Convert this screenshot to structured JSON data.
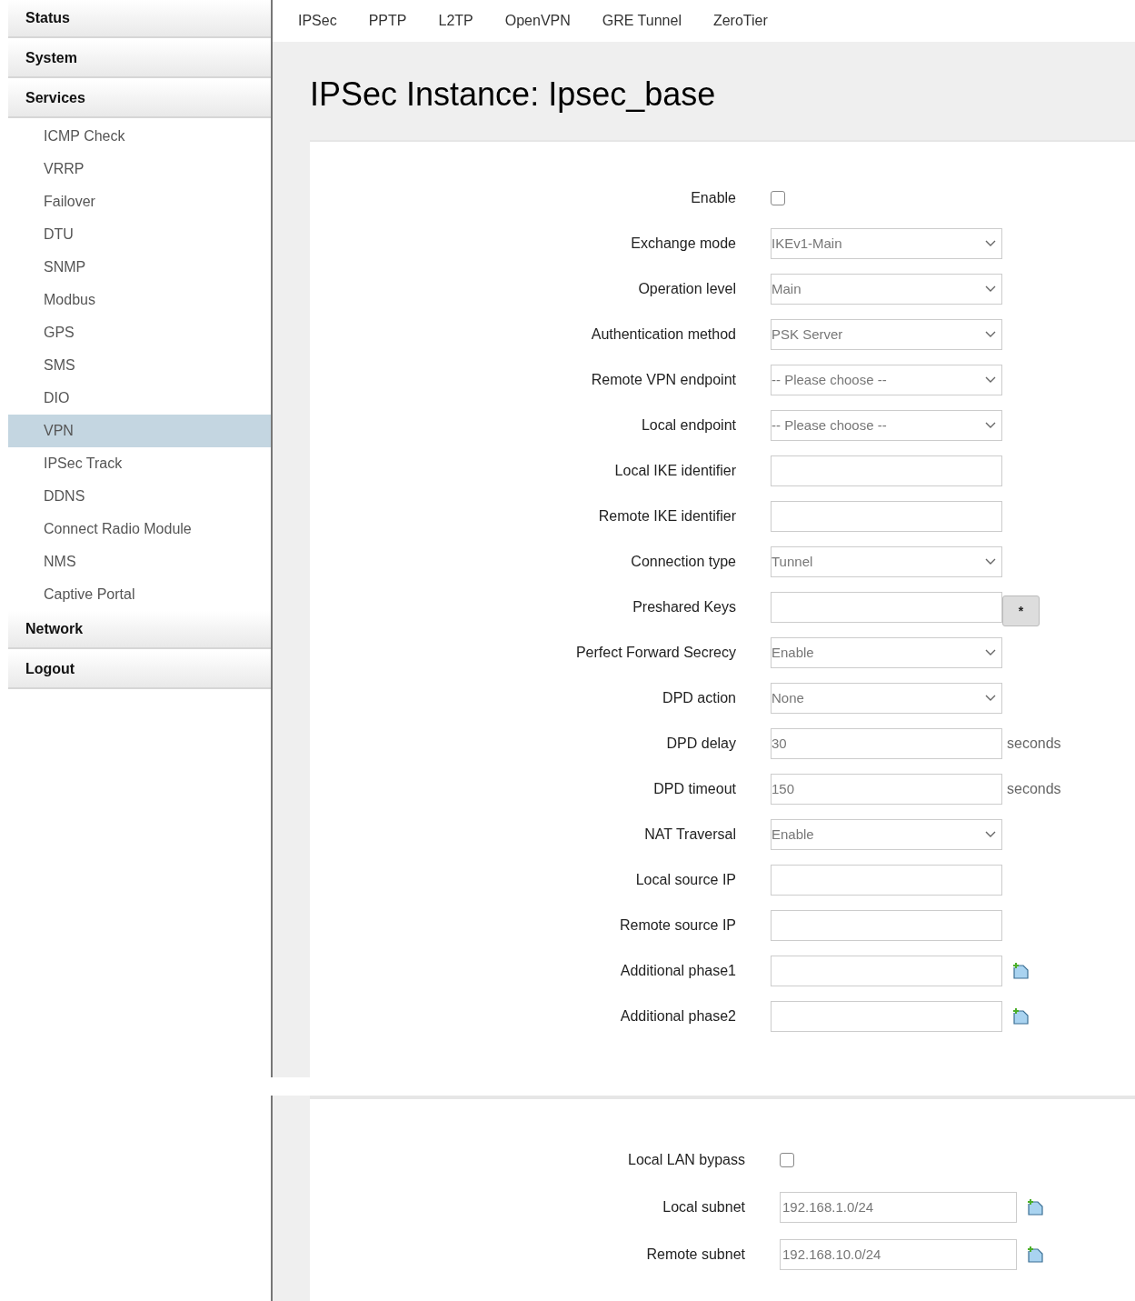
{
  "sidebar": {
    "items": [
      {
        "label": "Status",
        "kind": "header",
        "selected": false
      },
      {
        "label": "System",
        "kind": "header",
        "selected": false
      },
      {
        "label": "Services",
        "kind": "header",
        "selected": false
      },
      {
        "label": "ICMP Check",
        "kind": "sub",
        "selected": false
      },
      {
        "label": "VRRP",
        "kind": "sub",
        "selected": false
      },
      {
        "label": "Failover",
        "kind": "sub",
        "selected": false
      },
      {
        "label": "DTU",
        "kind": "sub",
        "selected": false
      },
      {
        "label": "SNMP",
        "kind": "sub",
        "selected": false
      },
      {
        "label": "Modbus",
        "kind": "sub",
        "selected": false
      },
      {
        "label": "GPS",
        "kind": "sub",
        "selected": false
      },
      {
        "label": "SMS",
        "kind": "sub",
        "selected": false
      },
      {
        "label": "DIO",
        "kind": "sub",
        "selected": false
      },
      {
        "label": "VPN",
        "kind": "sub",
        "selected": true
      },
      {
        "label": "IPSec Track",
        "kind": "sub",
        "selected": false
      },
      {
        "label": "DDNS",
        "kind": "sub",
        "selected": false
      },
      {
        "label": "Connect Radio Module",
        "kind": "sub",
        "selected": false
      },
      {
        "label": "NMS",
        "kind": "sub",
        "selected": false
      },
      {
        "label": "Captive Portal",
        "kind": "sub",
        "selected": false
      },
      {
        "label": "Network",
        "kind": "header",
        "selected": false
      },
      {
        "label": "Logout",
        "kind": "header",
        "selected": false
      }
    ]
  },
  "tabs": [
    {
      "label": "IPSec"
    },
    {
      "label": "PPTP"
    },
    {
      "label": "L2TP"
    },
    {
      "label": "OpenVPN"
    },
    {
      "label": "GRE Tunnel"
    },
    {
      "label": "ZeroTier"
    }
  ],
  "title": "IPSec Instance: Ipsec_base",
  "sections": [
    {
      "rows": [
        {
          "label": "Enable",
          "kind": "checkbox",
          "checked": false
        },
        {
          "label": "Exchange mode",
          "kind": "select",
          "value": "IKEv1-Main"
        },
        {
          "label": "Operation level",
          "kind": "select",
          "value": "Main"
        },
        {
          "label": "Authentication method",
          "kind": "select",
          "value": "PSK Server"
        },
        {
          "label": "Remote VPN endpoint",
          "kind": "select",
          "value": "-- Please choose --"
        },
        {
          "label": "Local endpoint",
          "kind": "select",
          "value": "-- Please choose --"
        },
        {
          "label": "Local IKE identifier",
          "kind": "input"
        },
        {
          "label": "Remote IKE identifier",
          "kind": "input"
        },
        {
          "label": "Connection type",
          "kind": "select",
          "value": "Tunnel"
        },
        {
          "label": "Preshared Keys",
          "kind": "password",
          "button": "*"
        },
        {
          "label": "Perfect Forward Secrecy",
          "kind": "select",
          "value": "Enable"
        },
        {
          "label": "DPD action",
          "kind": "select",
          "value": "None"
        },
        {
          "label": "DPD delay",
          "kind": "input",
          "value": "30",
          "suffix": "seconds"
        },
        {
          "label": "DPD timeout",
          "kind": "input",
          "value": "150",
          "suffix": "seconds"
        },
        {
          "label": "NAT Traversal",
          "kind": "select",
          "value": "Enable"
        },
        {
          "label": "Local source IP",
          "kind": "input"
        },
        {
          "label": "Remote source IP",
          "kind": "input"
        },
        {
          "label": "Additional phase1",
          "kind": "list"
        },
        {
          "label": "Additional phase2",
          "kind": "list"
        }
      ]
    },
    {
      "rows": [
        {
          "label": "Local LAN bypass",
          "kind": "checkbox",
          "checked": false
        },
        {
          "label": "Local subnet",
          "kind": "list",
          "value": "192.168.1.0/24"
        },
        {
          "label": "Remote subnet",
          "kind": "list",
          "value": "192.168.10.0/24"
        }
      ]
    }
  ]
}
